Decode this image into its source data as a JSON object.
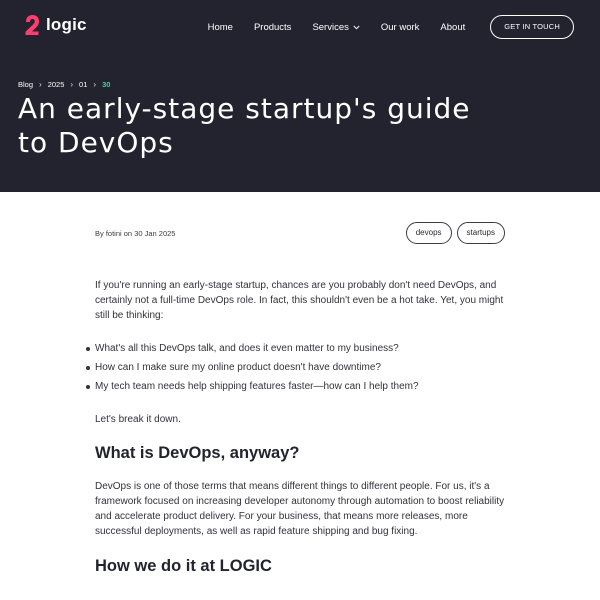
{
  "brand": {
    "name": "logic",
    "accent": "#ff3d6e"
  },
  "nav": {
    "items": [
      "Home",
      "Products",
      "Services",
      "Our work",
      "About"
    ],
    "cta": "GET IN TOUCH"
  },
  "breadcrumb": [
    "Blog",
    "2025",
    "01",
    "30"
  ],
  "colors": {
    "hero_bg": "#23232f",
    "breadcrumb_active": "#3ed49d"
  },
  "post": {
    "title": "An early-stage startup's guide to DevOps",
    "byline": "By fotini on 30 Jan 2025",
    "tags": [
      "devops",
      "startups"
    ],
    "intro": "If you're running an early-stage startup, chances are you probably don't need DevOps, and certainly not a full-time DevOps role. In fact, this shouldn't even be a hot take. Yet, you might still be thinking:",
    "bullets": [
      "What's all this DevOps talk, and does it even matter to my business?",
      "How can I make sure my online product doesn't have downtime?",
      "My tech team needs help shipping features faster—how can I help them?"
    ],
    "breakdown": "Let's break it down.",
    "section1_heading": "What is DevOps, anyway?",
    "section1_body": "DevOps is one of those terms that means different things to different people. For us, it's a framework focused on increasing developer autonomy through automation to boost reliability and accelerate product delivery. For your business, that means more releases, more successful deployments, as well as rapid feature shipping and bug fixing.",
    "section2_heading": "How we do it at LOGIC"
  }
}
